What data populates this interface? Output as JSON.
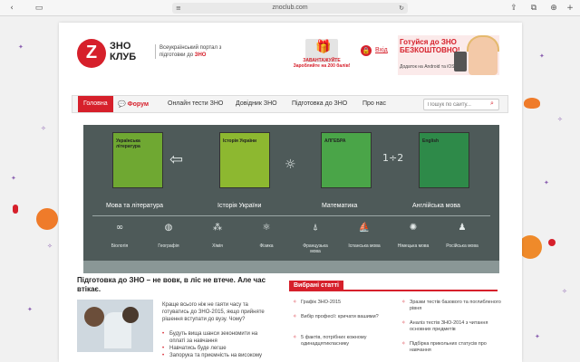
{
  "browser": {
    "url": "znoclub.com",
    "icons": [
      "sidebar-icon",
      "lock-icon",
      "reload-icon",
      "share-icon",
      "tabs-icon",
      "download-icon"
    ]
  },
  "site": {
    "logo_letter": "Z",
    "logo_line1": "ЗНО",
    "logo_line2": "КЛУБ",
    "tagline_prefix": "Всеукраїнський портал з підготовки до",
    "tagline_highlight": "ЗНО"
  },
  "promo": {
    "gift_label": "ЗАВАНТАЖУЙТЕ",
    "gift_line2": "Заробляйте на 200 балів!"
  },
  "login": {
    "label": "Вхід"
  },
  "ad": {
    "headline": "Готуйся до ЗНО БЕЗКОШТОВНО!",
    "subline": "Додаток на Android та iOS"
  },
  "nav": {
    "items": [
      "Головна",
      "Форум",
      "Онлайн тести ЗНО",
      "Довідник ЗНО",
      "Підготовка до ЗНО",
      "Про нас"
    ],
    "search_placeholder": "Пошук по сайту..."
  },
  "books": [
    {
      "title": "Українська література",
      "subject": "Мова та література",
      "color": "#6fa832"
    },
    {
      "title": "Історія України",
      "subject": "Історія України",
      "color": "#8db830"
    },
    {
      "title": "АЛГЕБРА",
      "subject": "Математика",
      "color": "#4aa548"
    },
    {
      "title": "English",
      "subject": "Англійська мова",
      "color": "#2e8a49"
    }
  ],
  "subjects_small": [
    "Біологія",
    "Географія",
    "Хімія",
    "Фізика",
    "Французька мова",
    "Іспанська мова",
    "Німецька мова",
    "Російська мова"
  ],
  "content": {
    "headline": "Підготовка до ЗНО – не вовк, в ліс не втече. Але час втікає.",
    "intro": "Краще всього ніж не гаяти часу та готуватись до ЗНО-2015, якщо прийняте рішення вступати до вузу. Чому?",
    "bullets": [
      "Будуть вища шанси зекономити на оплаті за навчання",
      "Навчатись буде легше",
      "Запорука та приємність на високому"
    ]
  },
  "selected": {
    "title": "Вибрані статті",
    "articles": [
      "Графік ЗНО-2015",
      "Вибір професії: кричати вашими?",
      "5 фактів, потрібних кожному одинадцятикласнику",
      "Зразки тестів базового та поглибленого рівня",
      "Аналіз тестів ЗНО-2014 з читання основних предметів",
      "Підбірка прикольних статусів про навчання"
    ]
  }
}
